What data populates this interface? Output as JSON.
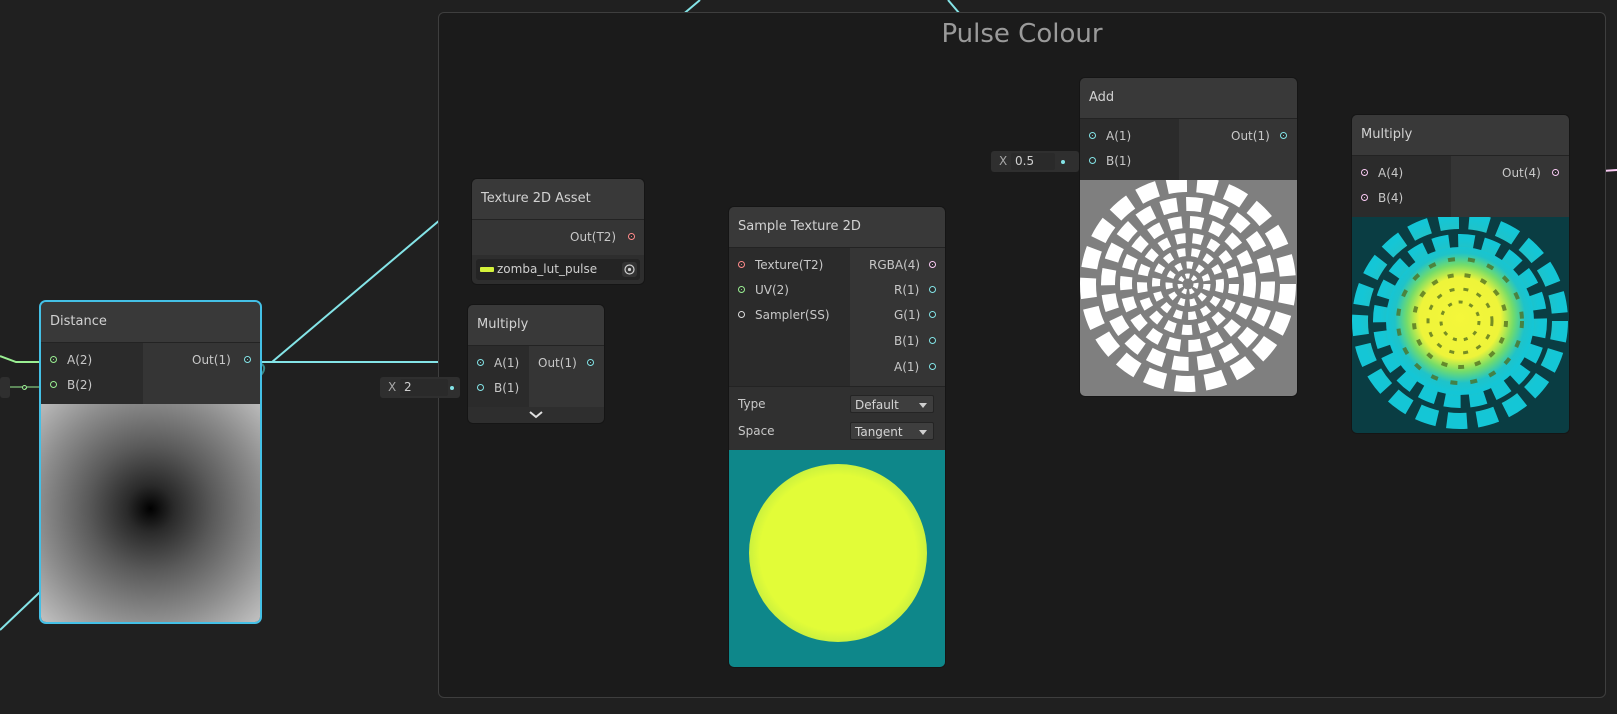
{
  "group": {
    "title": "Pulse Colour"
  },
  "distance_node": {
    "title": "Distance",
    "inputs": [
      "A(2)",
      "B(2)"
    ],
    "output": "Out(1)"
  },
  "texture_asset_node": {
    "title": "Texture 2D Asset",
    "output": "Out(T2)",
    "asset_name": "zomba_lut_pulse"
  },
  "multiply_small_node": {
    "title": "Multiply",
    "inputs": [
      "A(1)",
      "B(1)"
    ],
    "output": "Out(1)",
    "b_axis": "X",
    "b_value": "2"
  },
  "sample_texture_node": {
    "title": "Sample Texture 2D",
    "inputs": [
      "Texture(T2)",
      "UV(2)",
      "Sampler(SS)"
    ],
    "outputs": [
      "RGBA(4)",
      "R(1)",
      "G(1)",
      "B(1)",
      "A(1)"
    ],
    "type_label": "Type",
    "type_value": "Default",
    "space_label": "Space",
    "space_value": "Tangent"
  },
  "add_node": {
    "title": "Add",
    "inputs": [
      "A(1)",
      "B(1)"
    ],
    "output": "Out(1)",
    "b_axis": "X",
    "b_value": "0.5"
  },
  "multiply_color_node": {
    "title": "Multiply",
    "inputs": [
      "A(4)",
      "B(4)"
    ],
    "output": "Out(4)"
  },
  "colors": {
    "float_port": "#84e4e7",
    "vector2_port": "#9aef92",
    "vector4_port": "#fbcbf4",
    "texture_port": "#ff8b8b",
    "sampler_port": "#dcdcdc",
    "selection": "#44c0e6",
    "background": "#202020"
  }
}
